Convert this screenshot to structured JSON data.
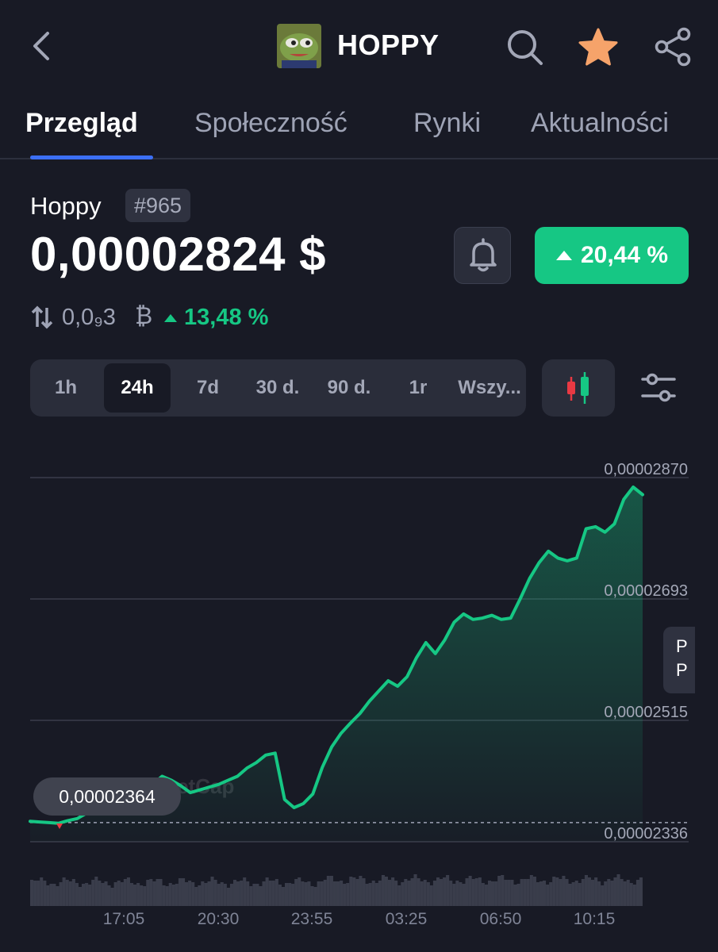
{
  "header": {
    "title": "HOPPY",
    "back_icon": "chevron-left-icon",
    "search_icon": "search-icon",
    "favorite_icon": "star-icon",
    "favorite_color": "#f6a36a",
    "share_icon": "share-icon"
  },
  "tabs": [
    {
      "label": "Przegląd",
      "active": true
    },
    {
      "label": "Społeczność",
      "active": false
    },
    {
      "label": "Rynki",
      "active": false
    },
    {
      "label": "Aktualności",
      "active": false
    }
  ],
  "coin": {
    "name": "Hoppy",
    "rank": "#965",
    "price": "0,00002824 $",
    "change_24h": "20,44 %",
    "btc_value": "0,0₉3",
    "btc_symbol": "₿",
    "btc_change": "13,48 %"
  },
  "colors": {
    "accent": "#3c6ff5",
    "positive": "#16c784",
    "negative": "#ea3943",
    "background": "#181a25"
  },
  "range": {
    "options": [
      "1h",
      "24h",
      "7d",
      "30 d.",
      "90 d.",
      "1r",
      "Wszy..."
    ],
    "selected": "24h"
  },
  "chart_data": {
    "type": "area",
    "y_axis_labels": [
      "0,00002870",
      "0,00002693",
      "0,00002515",
      "0,00002336"
    ],
    "ylim": [
      2.336e-05,
      2.87e-05
    ],
    "x_tick_labels": [
      "17:05",
      "20:30",
      "23:55",
      "03:25",
      "06:50",
      "10:15"
    ],
    "reference_line_label": "0,00002364",
    "reference_value": 2.364e-05,
    "grid": true,
    "watermark": "CoinMarketCap",
    "series": [
      {
        "values": [
          2.366e-05,
          2.365e-05,
          2.364e-05,
          2.363e-05,
          2.367e-05,
          2.37e-05,
          2.378e-05,
          2.385e-05,
          2.392e-05,
          2.398e-05,
          2.404e-05,
          2.402e-05,
          2.412e-05,
          2.42e-05,
          2.432e-05,
          2.426e-05,
          2.418e-05,
          2.408e-05,
          2.412e-05,
          2.416e-05,
          2.42e-05,
          2.426e-05,
          2.432e-05,
          2.444e-05,
          2.452e-05,
          2.463e-05,
          2.466e-05,
          2.398e-05,
          2.386e-05,
          2.392e-05,
          2.406e-05,
          2.445e-05,
          2.475e-05,
          2.495e-05,
          2.51e-05,
          2.524e-05,
          2.542e-05,
          2.557e-05,
          2.572e-05,
          2.564e-05,
          2.578e-05,
          2.606e-05,
          2.628e-05,
          2.612e-05,
          2.632e-05,
          2.658e-05,
          2.67e-05,
          2.662e-05,
          2.664e-05,
          2.668e-05,
          2.662e-05,
          2.664e-05,
          2.692e-05,
          2.722e-05,
          2.745e-05,
          2.762e-05,
          2.752e-05,
          2.748e-05,
          2.752e-05,
          2.795e-05,
          2.798e-05,
          2.79e-05,
          2.802e-05,
          2.838e-05,
          2.856e-05,
          2.845e-05
        ]
      }
    ],
    "volume_note": "volume bars beneath price"
  },
  "side_tab": {
    "line1": "P",
    "line2": "P"
  }
}
